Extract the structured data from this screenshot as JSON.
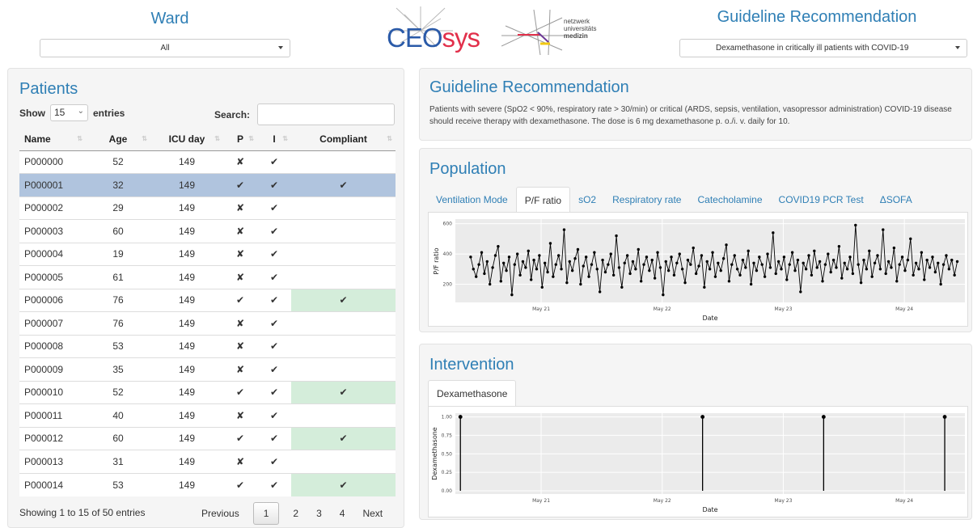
{
  "header": {
    "ward_title": "Ward",
    "ward_value": "All",
    "guideline_title": "Guideline Recommendation",
    "guideline_value": "Dexamethasone in critically ill patients with COVID-19",
    "logo_ceosys_a": "CEO",
    "logo_ceosys_b": "sys",
    "logo_nm_1": "netzwerk",
    "logo_nm_2": "universitäts",
    "logo_nm_3": "medizin"
  },
  "patients": {
    "title": "Patients",
    "show_label": "Show",
    "length_value": "15",
    "entries_label": "entries",
    "search_label": "Search:",
    "search_value": "",
    "columns": [
      "Name",
      "Age",
      "ICU day",
      "P",
      "I",
      "Compliant"
    ],
    "rows": [
      {
        "name": "P000000",
        "age": "52",
        "icu": "149",
        "p": "✘",
        "i": "✔",
        "c": ""
      },
      {
        "name": "P000001",
        "age": "32",
        "icu": "149",
        "p": "✔",
        "i": "✔",
        "c": "✔"
      },
      {
        "name": "P000002",
        "age": "29",
        "icu": "149",
        "p": "✘",
        "i": "✔",
        "c": ""
      },
      {
        "name": "P000003",
        "age": "60",
        "icu": "149",
        "p": "✘",
        "i": "✔",
        "c": ""
      },
      {
        "name": "P000004",
        "age": "19",
        "icu": "149",
        "p": "✘",
        "i": "✔",
        "c": ""
      },
      {
        "name": "P000005",
        "age": "61",
        "icu": "149",
        "p": "✘",
        "i": "✔",
        "c": ""
      },
      {
        "name": "P000006",
        "age": "76",
        "icu": "149",
        "p": "✔",
        "i": "✔",
        "c": "✔"
      },
      {
        "name": "P000007",
        "age": "76",
        "icu": "149",
        "p": "✘",
        "i": "✔",
        "c": ""
      },
      {
        "name": "P000008",
        "age": "53",
        "icu": "149",
        "p": "✘",
        "i": "✔",
        "c": ""
      },
      {
        "name": "P000009",
        "age": "35",
        "icu": "149",
        "p": "✘",
        "i": "✔",
        "c": ""
      },
      {
        "name": "P000010",
        "age": "52",
        "icu": "149",
        "p": "✔",
        "i": "✔",
        "c": "✔"
      },
      {
        "name": "P000011",
        "age": "40",
        "icu": "149",
        "p": "✘",
        "i": "✔",
        "c": ""
      },
      {
        "name": "P000012",
        "age": "60",
        "icu": "149",
        "p": "✔",
        "i": "✔",
        "c": "✔"
      },
      {
        "name": "P000013",
        "age": "31",
        "icu": "149",
        "p": "✘",
        "i": "✔",
        "c": ""
      },
      {
        "name": "P000014",
        "age": "53",
        "icu": "149",
        "p": "✔",
        "i": "✔",
        "c": "✔"
      }
    ],
    "selected_row": "P000001",
    "info": "Showing 1 to 15 of 50 entries",
    "pager": {
      "previous": "Previous",
      "pages": [
        "1",
        "2",
        "3",
        "4"
      ],
      "current": "1",
      "next": "Next"
    }
  },
  "guideline": {
    "title": "Guideline Recommendation",
    "text": "Patients with severe (SpO2 < 90%, respiratory rate > 30/min) or critical (ARDS, sepsis, ventilation, vasopressor administration) COVID-19 disease should receive therapy with dexamethasone. The dose is 6 mg dexamethasone p. o./i. v. daily for 10."
  },
  "population": {
    "title": "Population",
    "tabs": [
      "Ventilation Mode",
      "P/F ratio",
      "sO2",
      "Respiratory rate",
      "Catecholamine",
      "COVID19 PCR Test",
      "ΔSOFA"
    ],
    "active_tab": "P/F ratio"
  },
  "intervention": {
    "title": "Intervention",
    "tabs": [
      "Dexamethasone"
    ],
    "active_tab": "Dexamethasone"
  },
  "colors": {
    "accent": "#2f7fb5",
    "selected_row": "#b0c4de",
    "compliant_bg": "#d4edda",
    "panel_bg": "#f5f5f5",
    "plot_bg": "#ebebeb"
  },
  "chart_data": [
    {
      "type": "line",
      "xlabel": "Date",
      "ylabel": "P/F ratio",
      "x_ticks": [
        "May 21",
        "May 22",
        "May 23",
        "May 24"
      ],
      "y_ticks": [
        "200",
        "400",
        "600"
      ],
      "xlim": [
        "2020-05-20 07:00",
        "2020-05-24 12:00"
      ],
      "ylim": [
        80,
        630
      ],
      "grid": true,
      "series": [
        {
          "values": [
            380,
            300,
            250,
            330,
            410,
            270,
            350,
            200,
            310,
            390,
            450,
            220,
            340,
            290,
            380,
            130,
            330,
            400,
            260,
            350,
            310,
            420,
            230,
            360,
            300,
            390,
            180,
            340,
            280,
            470,
            250,
            330,
            390,
            300,
            560,
            210,
            350,
            290,
            370,
            430,
            200,
            320,
            380,
            250,
            330,
            410,
            300,
            150,
            360,
            280,
            330,
            400,
            260,
            520,
            310,
            180,
            340,
            390,
            270,
            350,
            300,
            430,
            220,
            330,
            380,
            290,
            360,
            240,
            410,
            310,
            130,
            350,
            290,
            380,
            260,
            340,
            400,
            300,
            210,
            360,
            330,
            440,
            270,
            320,
            390,
            180,
            350,
            300,
            410,
            250,
            340,
            290,
            370,
            460,
            220,
            330,
            390,
            300,
            260,
            360,
            310,
            420,
            200,
            340,
            290,
            380,
            330,
            250,
            400,
            310,
            540,
            270,
            350,
            300,
            380,
            230,
            330,
            410,
            290,
            360,
            150,
            340,
            300,
            390,
            260,
            420,
            310,
            350,
            220,
            330,
            400,
            280,
            360,
            310,
            450,
            240,
            340,
            300,
            380,
            270,
            590,
            330,
            210,
            360,
            300,
            420,
            250,
            340,
            390,
            300,
            560,
            270,
            350,
            310,
            440,
            220,
            330,
            380,
            290,
            360,
            500,
            260,
            340,
            300,
            410,
            230,
            360,
            310,
            380,
            280,
            340,
            200,
            330,
            390,
            300,
            360,
            260,
            350
          ]
        }
      ]
    },
    {
      "type": "bar",
      "xlabel": "Date",
      "ylabel": "Dexamethasone",
      "x_ticks": [
        "May 21",
        "May 22",
        "May 23",
        "May 24"
      ],
      "y_ticks": [
        "0.00",
        "0.25",
        "0.50",
        "0.75",
        "1.00"
      ],
      "ylim": [
        0,
        1.05
      ],
      "grid": true,
      "series": [
        {
          "x": [
            "2020-05-20 08:00",
            "2020-05-22 08:00",
            "2020-05-23 08:00",
            "2020-05-24 08:00"
          ],
          "values": [
            1,
            1,
            1,
            1
          ]
        }
      ]
    }
  ]
}
